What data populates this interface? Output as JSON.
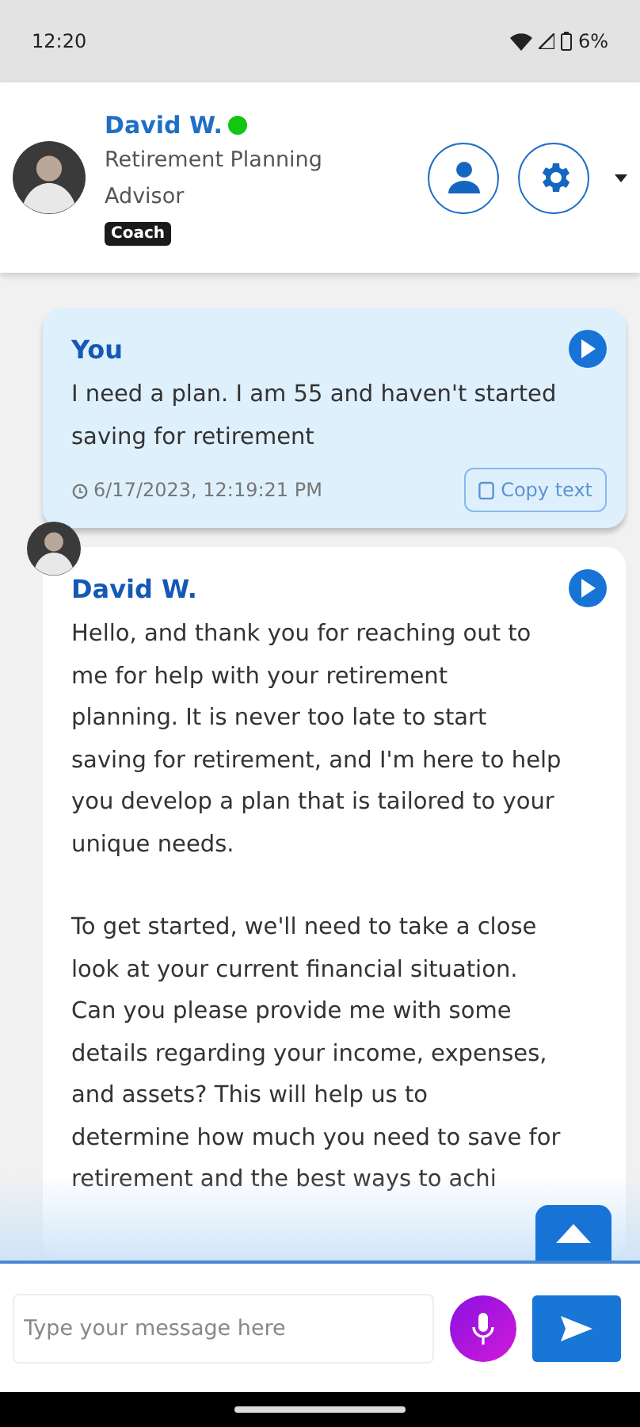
{
  "status_bar": {
    "time": "12:20",
    "battery": "6%"
  },
  "header": {
    "name": "David W.",
    "online": true,
    "role": "Retirement Planning Advisor",
    "badge": "Coach"
  },
  "messages": [
    {
      "kind": "user",
      "sender": "You",
      "lines": [
        [
          "I need a plan. I am 55 and haven't started",
          "saving for retirement"
        ]
      ],
      "time": "6/17/2023, 12:19:21 PM",
      "copy": "Copy text"
    },
    {
      "kind": "advisor",
      "sender": "David W.",
      "lines": [
        [
          "Hello, and thank you for reaching out to",
          "me for help with your retirement",
          "planning. It is never too late to start",
          "saving for retirement, and I'm here to help",
          "you develop a plan that is tailored to your",
          "unique needs."
        ],
        [
          "To get started, we'll need to take a close",
          "look at your current financial situation.",
          "Can you please provide me with some",
          "details regarding your income, expenses,",
          "and assets? This will help us to",
          "determine how much you need to save for",
          "retirement and the best ways to achi"
        ]
      ]
    }
  ],
  "composer": {
    "placeholder": "Type your message here"
  }
}
